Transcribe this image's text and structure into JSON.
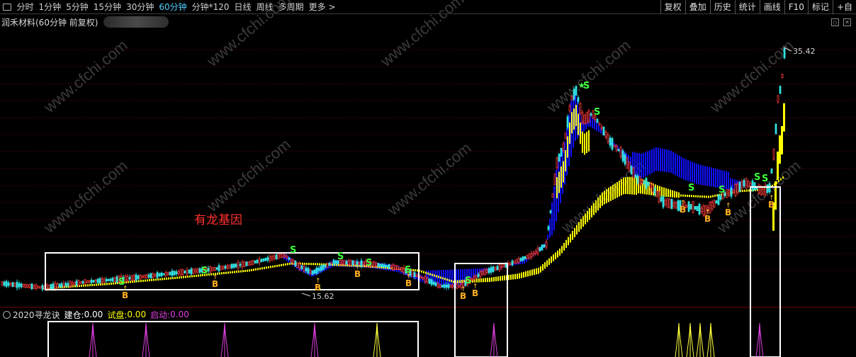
{
  "toolbar": {
    "periods": [
      "分时",
      "1分钟",
      "5分钟",
      "15分钟",
      "30分钟",
      "60分钟",
      "分钟*120",
      "日线",
      "周线",
      "多周期",
      "更多 >"
    ],
    "active_period_index": 5,
    "tools": [
      "复权",
      "叠加",
      "历史",
      "统计",
      "画线",
      "F10",
      "标记",
      "+自"
    ]
  },
  "header": {
    "title": "润禾材料(60分钟 前复权)",
    "blurred_name": "",
    "restore_icon": "restore-window-icon",
    "close_icon": "close-icon"
  },
  "watermark": "www.cfchi.com",
  "annotation": "有龙基因",
  "price_labels": {
    "high": "35.42",
    "low": "15.62"
  },
  "signal_letters": {
    "buy": "B",
    "sell": "S"
  },
  "indicator": {
    "name": "2020寻龙诀",
    "items": [
      {
        "label": "建仓:",
        "value": "0.00",
        "color": "#ffffff"
      },
      {
        "label": "试盘:",
        "value": "0.00",
        "color": "#ffff00"
      },
      {
        "label": "启动:",
        "value": "0.00",
        "color": "#e040e0"
      }
    ]
  },
  "colors": {
    "up": "#ff3a3a",
    "down": "#30e0e0",
    "blue_band": "#1010ff",
    "yellow_band": "#ffff00",
    "highlight_box": "#ffffff",
    "grid": "#7a0000",
    "annotation": "#ff3030",
    "sell_signal": "#3cff3c",
    "buy_signal": "#ffb020",
    "spike_magenta": "#e040e0",
    "spike_yellow": "#ffff40"
  }
}
